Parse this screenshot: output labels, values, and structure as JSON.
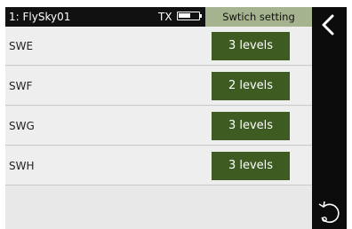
{
  "header": {
    "title": "1: FlySky01",
    "tx_label": "TX",
    "page_title": "Swtich setting",
    "battery_level": 0.65
  },
  "rows": [
    {
      "label": "SWE",
      "value": "3 levels"
    },
    {
      "label": "SWF",
      "value": "2 levels"
    },
    {
      "label": "SWG",
      "value": "3 levels"
    },
    {
      "label": "SWH",
      "value": "3 levels"
    }
  ],
  "sidebar": {
    "back_icon": "chevron-left-icon",
    "refresh_icon": "rotate-icon"
  },
  "colors": {
    "header_bg": "#111111",
    "title_bar_bg": "#a5b38f",
    "button_bg": "#3e5b21",
    "list_bg": "#eeeeee",
    "sidebar_bg": "#0c0c0c"
  }
}
